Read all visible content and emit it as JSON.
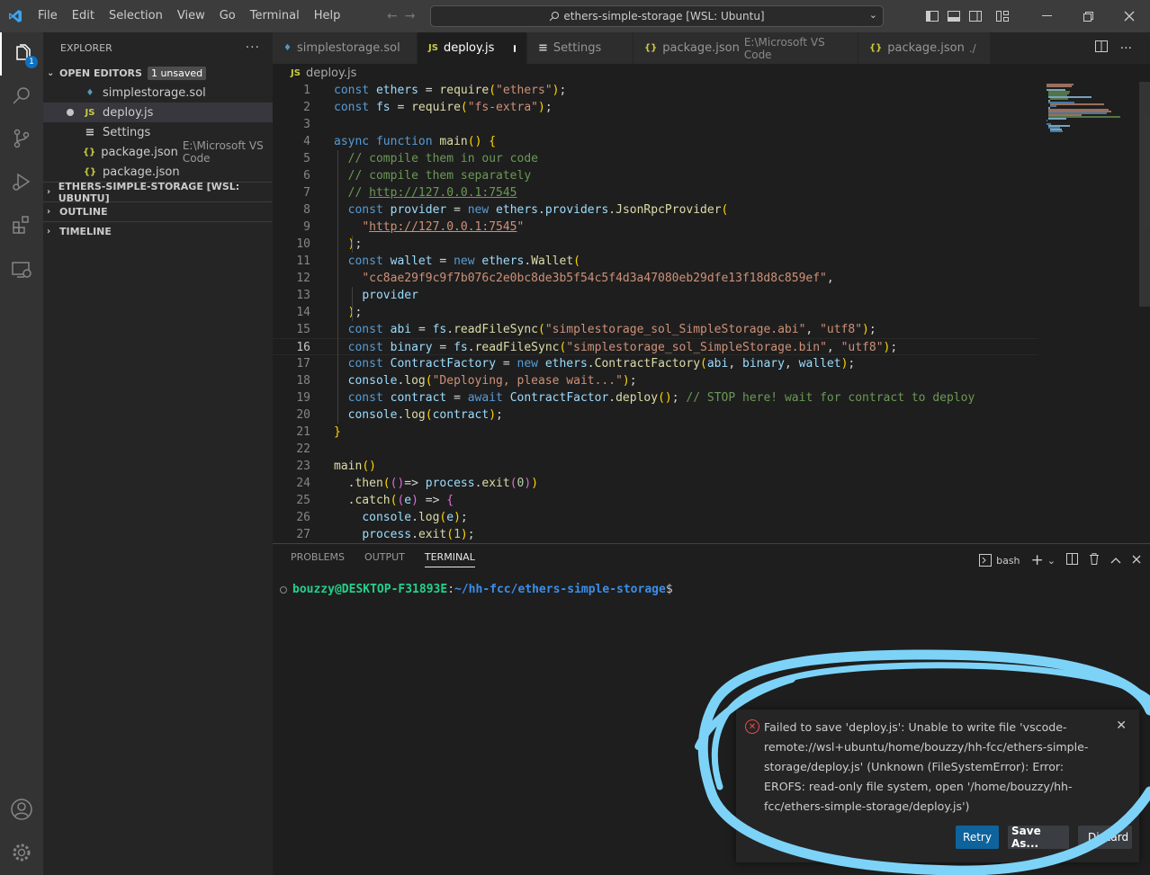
{
  "titlebar": {
    "menu": [
      "File",
      "Edit",
      "Selection",
      "View",
      "Go",
      "Terminal",
      "Help"
    ],
    "search": "ethers-simple-storage [WSL: Ubuntu]"
  },
  "activity": {
    "explorer_badge": "1",
    "icons": [
      "files-icon",
      "search-icon",
      "source-control-icon",
      "run-debug-icon",
      "extensions-icon",
      "remote-explorer-icon",
      "account-icon",
      "settings-gear-icon"
    ]
  },
  "sidebar": {
    "title": "EXPLORER",
    "open_editors": "OPEN EDITORS",
    "unsaved": "1 unsaved",
    "items": [
      {
        "icon": "♦",
        "label": "simplestorage.sol",
        "path": ""
      },
      {
        "icon": "JS",
        "label": "deploy.js",
        "path": ""
      },
      {
        "icon": "≡",
        "label": "Settings",
        "path": ""
      },
      {
        "icon": "{}",
        "label": "package.json",
        "path": "E:\\Microsoft VS Code"
      },
      {
        "icon": "{}",
        "label": "package.json",
        "path": ""
      }
    ],
    "sections": [
      "ETHERS-SIMPLE-STORAGE [WSL: UBUNTU]",
      "OUTLINE",
      "TIMELINE"
    ]
  },
  "tabs": [
    {
      "icon": "♦",
      "label": "simplestorage.sol",
      "path": ""
    },
    {
      "icon": "JS",
      "label": "deploy.js",
      "path": ""
    },
    {
      "icon": "≡",
      "label": "Settings",
      "path": ""
    },
    {
      "icon": "{}",
      "label": "package.json",
      "path": "E:\\Microsoft VS Code"
    },
    {
      "icon": "{}",
      "label": "package.json",
      "path": "./"
    }
  ],
  "breadcrumb": "deploy.js",
  "editor": {
    "line_numbers": [
      "1",
      "2",
      "3",
      "4",
      "5",
      "6",
      "7",
      "8",
      "9",
      "10",
      "11",
      "12",
      "13",
      "14",
      "15",
      "16",
      "17",
      "18",
      "19",
      "20",
      "21",
      "22",
      "23",
      "24",
      "25",
      "26",
      "27"
    ],
    "current_line": 16,
    "lines": [
      "const ethers = require(\"ethers\");",
      "const fs = require(\"fs-extra\");",
      "",
      "async function main() {",
      "  // compile them in our code",
      "  // compile them separately",
      "  // http://127.0.0.1:7545",
      "  const provider = new ethers.providers.JsonRpcProvider(",
      "    \"http://127.0.0.1:7545\"",
      "  );",
      "  const wallet = new ethers.Wallet(",
      "    \"cc8ae29f9c9f7b076c2e0bc8de3b5f54c5f4d3a47080eb29dfe13f18d8c859ef\",",
      "    provider",
      "  );",
      "  const abi = fs.readFileSync(\"simplestorage_sol_SimpleStorage.abi\", \"utf8\");",
      "  const binary = fs.readFileSync(\"simplestorage_sol_SimpleStorage.bin\", \"utf8\");",
      "  const ContractFactory = new ethers.ContractFactory(abi, binary, wallet);",
      "  console.log(\"Deploying, please wait...\");",
      "  const contract = await ContractFactor.deploy(); // STOP here! wait for contract to deploy",
      "  console.log(contract);",
      "}",
      "",
      "main()",
      "  .then(()=> process.exit(0))",
      "  .catch((e) => {",
      "    console.log(e);",
      "    process.exit(1);"
    ]
  },
  "panel": {
    "tabs": [
      "PROBLEMS",
      "OUTPUT",
      "TERMINAL"
    ],
    "shell": "bash",
    "prompt_user": "bouzzy@DESKTOP-F31893E",
    "prompt_sep": ":",
    "prompt_path": "~/hh-fcc/ethers-simple-storage",
    "prompt_end": "$"
  },
  "notification": {
    "message": "Failed to save 'deploy.js': Unable to write file 'vscode-remote://wsl+ubuntu/home/bouzzy/hh-fcc/ethers-simple-storage/deploy.js' (Unknown (FileSystemError): Error: EROFS: read-only file system, open '/home/bouzzy/hh-fcc/ethers-simple-storage/deploy.js')",
    "retry": "Retry",
    "save_as": "Save As...",
    "discard": "Discard"
  },
  "colors": {
    "accent": "#0e639c",
    "error": "#f14c4c",
    "annotation": "#7dd3f7"
  }
}
